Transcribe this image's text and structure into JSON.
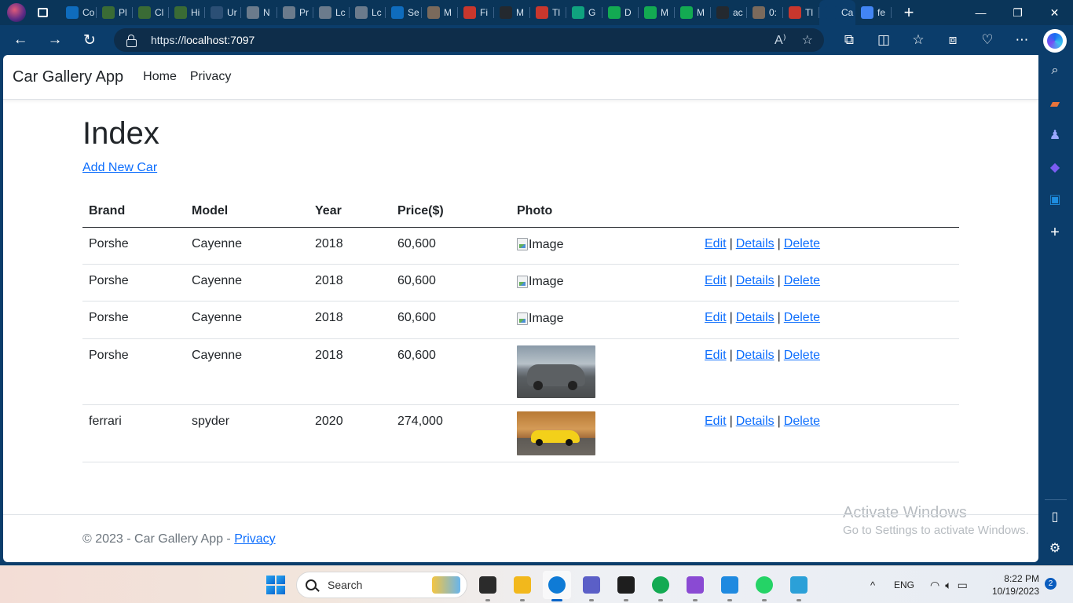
{
  "browser": {
    "tabs": [
      {
        "label": "Co",
        "color": "#0f6cbd"
      },
      {
        "label": "Pl",
        "color": "#3a6b35"
      },
      {
        "label": "Cl",
        "color": "#3a6b35"
      },
      {
        "label": "Hi",
        "color": "#3a6b35"
      },
      {
        "label": "Ur",
        "color": "#2b4f75"
      },
      {
        "label": "N",
        "color": "#6b7b8c"
      },
      {
        "label": "Pr",
        "color": "#6b7b8c"
      },
      {
        "label": "Lc",
        "color": "#6b7b8c"
      },
      {
        "label": "Lc",
        "color": "#6b7b8c"
      },
      {
        "label": "Se",
        "color": "#0f6cbd"
      },
      {
        "label": "M",
        "color": "#7a6a5c"
      },
      {
        "label": "Fi",
        "color": "#c8372d"
      },
      {
        "label": "M",
        "color": "#24292f"
      },
      {
        "label": "Tl",
        "color": "#c8372d"
      },
      {
        "label": "G",
        "color": "#10a37f"
      },
      {
        "label": "D",
        "color": "#13aa52"
      },
      {
        "label": "M",
        "color": "#13aa52"
      },
      {
        "label": "M",
        "color": "#13aa52"
      },
      {
        "label": "ac",
        "color": "#24292f"
      },
      {
        "label": "0:",
        "color": "#7a6a5c"
      },
      {
        "label": "Tl",
        "color": "#c8372d"
      },
      {
        "label": "Ca",
        "color": "#0b3d6b",
        "active": true
      },
      {
        "label": "fe",
        "color": "#4285f4"
      }
    ],
    "tab_close": "✕",
    "new_tab": "+",
    "url_prefix": "https://",
    "url_host": "localhost:7097",
    "window_controls": [
      "—",
      "❐",
      "✕"
    ]
  },
  "app": {
    "brand": "Car Gallery App",
    "nav": [
      "Home",
      "Privacy"
    ]
  },
  "page": {
    "title": "Index",
    "add_link": "Add New Car"
  },
  "table": {
    "headers": [
      "Brand",
      "Model",
      "Year",
      "Price($)",
      "Photo",
      ""
    ],
    "rows": [
      {
        "brand": "Porshe",
        "model": "Cayenne",
        "year": "2018",
        "price": "60,600",
        "photo": "broken",
        "alt": "Image"
      },
      {
        "brand": "Porshe",
        "model": "Cayenne",
        "year": "2018",
        "price": "60,600",
        "photo": "broken",
        "alt": "Image"
      },
      {
        "brand": "Porshe",
        "model": "Cayenne",
        "year": "2018",
        "price": "60,600",
        "photo": "broken",
        "alt": "Image"
      },
      {
        "brand": "Porshe",
        "model": "Cayenne",
        "year": "2018",
        "price": "60,600",
        "photo": "porsche-thumbnail"
      },
      {
        "brand": "ferrari",
        "model": "spyder",
        "year": "2020",
        "price": "274,000",
        "photo": "ferrari-thumbnail"
      }
    ],
    "actions": [
      "Edit",
      "Details",
      "Delete"
    ],
    "separator": "|"
  },
  "footer": {
    "text": "© 2023 - Car Gallery App - ",
    "link": "Privacy"
  },
  "watermark": {
    "line1": "Activate Windows",
    "line2": "Go to Settings to activate Windows."
  },
  "taskbar": {
    "search_placeholder": "Search",
    "apps": [
      {
        "name": "terminal-dark",
        "color": "#2b2b2b"
      },
      {
        "name": "file-explorer",
        "color": "#f2b81c"
      },
      {
        "name": "edge",
        "color": "#0f7bd6",
        "active": true
      },
      {
        "name": "teams",
        "color": "#5b5fc7"
      },
      {
        "name": "terminal",
        "color": "#1e1e1e"
      },
      {
        "name": "mongodb-compass",
        "color": "#13aa52"
      },
      {
        "name": "visual-studio",
        "color": "#8a4ad3"
      },
      {
        "name": "vscode",
        "color": "#1f8ae0"
      },
      {
        "name": "whatsapp",
        "color": "#25d366"
      },
      {
        "name": "notepad",
        "color": "#2ba0d8"
      }
    ],
    "language": "ENG",
    "time": "8:22 PM",
    "date": "10/19/2023",
    "notification_count": "2"
  }
}
